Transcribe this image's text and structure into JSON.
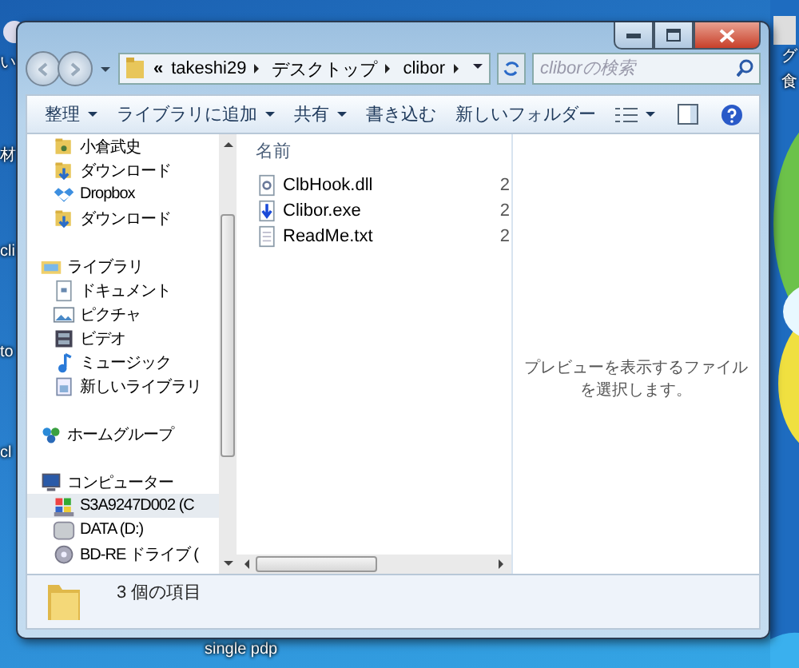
{
  "desktop": {
    "icon_labels": [
      {
        "text": "い"
      },
      {
        "text": "材"
      },
      {
        "text": "cli"
      },
      {
        "text": "to"
      },
      {
        "text": "cl"
      },
      {
        "text": "グ"
      },
      {
        "text": "食"
      },
      {
        "text": "single pdp"
      }
    ]
  },
  "address_bar": {
    "overflow": "«",
    "path": [
      "takeshi29",
      "デスクトップ",
      "clibor"
    ]
  },
  "search": {
    "placeholder": "cliborの検索"
  },
  "toolbar": {
    "items": [
      {
        "label": "整理",
        "dropdown": true
      },
      {
        "label": "ライブラリに追加",
        "dropdown": true
      },
      {
        "label": "共有",
        "dropdown": true
      },
      {
        "label": "書き込む",
        "dropdown": false
      },
      {
        "label": "新しいフォルダー",
        "dropdown": false
      }
    ]
  },
  "nav": {
    "favorites": [
      {
        "label": "小倉武史",
        "kind": "user-folder",
        "selected": false
      },
      {
        "label": "ダウンロード",
        "kind": "download",
        "selected": false
      },
      {
        "label": "Dropbox",
        "kind": "dropbox",
        "selected": false
      },
      {
        "label": "ダウンロード",
        "kind": "download",
        "selected": false
      }
    ],
    "groups": [
      {
        "label": "ライブラリ",
        "kind": "library",
        "selected": false,
        "children": [
          {
            "label": "ドキュメント",
            "kind": "document",
            "selected": false
          },
          {
            "label": "ピクチャ",
            "kind": "picture",
            "selected": false
          },
          {
            "label": "ビデオ",
            "kind": "video",
            "selected": false
          },
          {
            "label": "ミュージック",
            "kind": "music",
            "selected": false
          },
          {
            "label": "新しいライブラリ",
            "kind": "library-file",
            "selected": false
          }
        ]
      },
      {
        "label": "ホームグループ",
        "kind": "homegroup",
        "selected": false
      },
      {
        "label": "コンピューター",
        "kind": "computer",
        "selected": false,
        "children": [
          {
            "label": "S3A9247D002 (C",
            "kind": "system-drive",
            "selected": true
          },
          {
            "label": "DATA (D:)",
            "kind": "drive",
            "selected": false
          },
          {
            "label": "BD-RE ドライブ (",
            "kind": "disc",
            "selected": false
          }
        ]
      }
    ]
  },
  "file_list": {
    "columns": [
      {
        "label": "名前"
      }
    ],
    "rows": [
      {
        "name": "ClbHook.dll",
        "kind": "dll",
        "column_2": "2"
      },
      {
        "name": "Clibor.exe",
        "kind": "exe",
        "column_2": "2"
      },
      {
        "name": "ReadMe.txt",
        "kind": "txt",
        "column_2": "2"
      }
    ]
  },
  "preview": {
    "message": "プレビューを表示するファイルを選択します。"
  },
  "status_bar": {
    "count": "3 個の項目"
  }
}
